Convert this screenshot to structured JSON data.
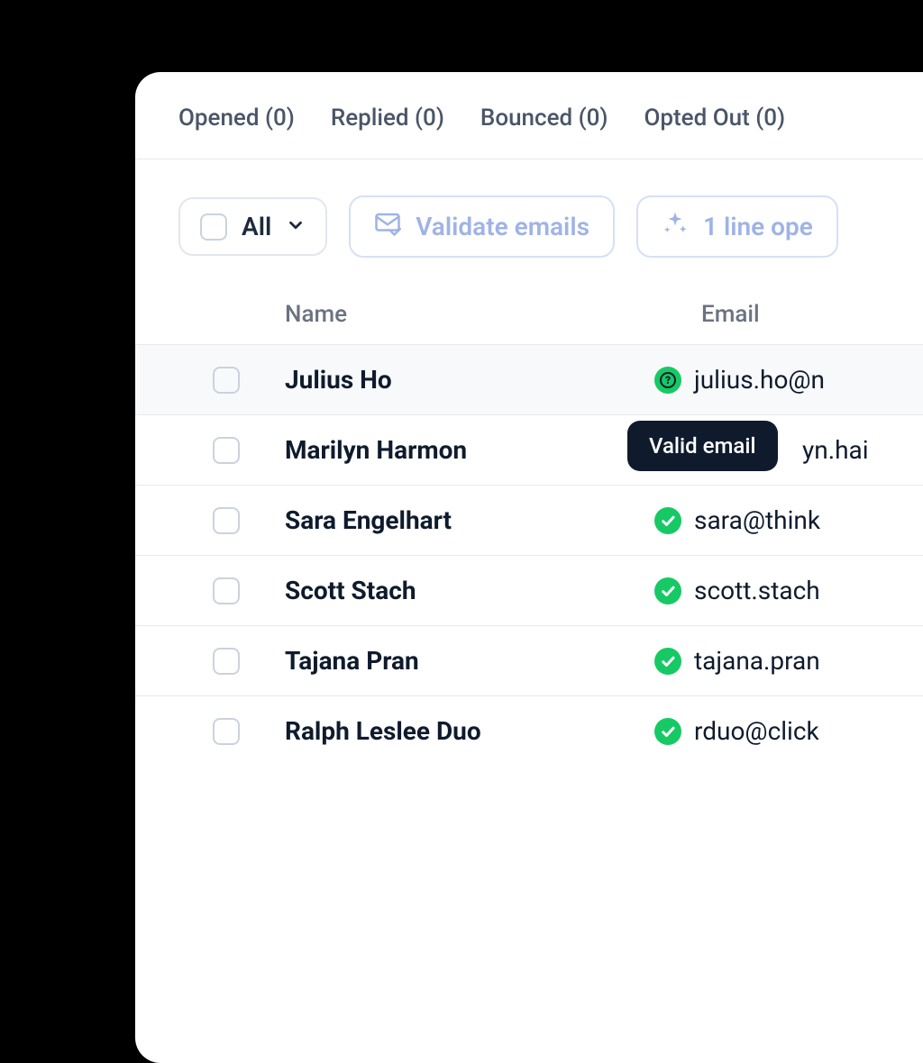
{
  "tabs": [
    {
      "label": "Opened (0)"
    },
    {
      "label": "Replied (0)"
    },
    {
      "label": "Bounced (0)"
    },
    {
      "label": "Opted Out (0)"
    }
  ],
  "toolbar": {
    "all_label": "All",
    "validate_label": "Validate emails",
    "opener_label": "1 line ope"
  },
  "columns": {
    "name": "Name",
    "email": "Email"
  },
  "tooltip": "Valid email",
  "rows": [
    {
      "name": "Julius Ho",
      "email": "julius.ho@n",
      "status": "unknown"
    },
    {
      "name": "Marilyn Harmon",
      "email": "yn.hai",
      "status": "valid"
    },
    {
      "name": "Sara Engelhart",
      "email": "sara@think",
      "status": "valid"
    },
    {
      "name": "Scott Stach",
      "email": "scott.stach",
      "status": "valid"
    },
    {
      "name": "Tajana Pran",
      "email": "tajana.pran",
      "status": "valid"
    },
    {
      "name": "Ralph Leslee Duo",
      "email": "rduo@click",
      "status": "valid"
    }
  ]
}
